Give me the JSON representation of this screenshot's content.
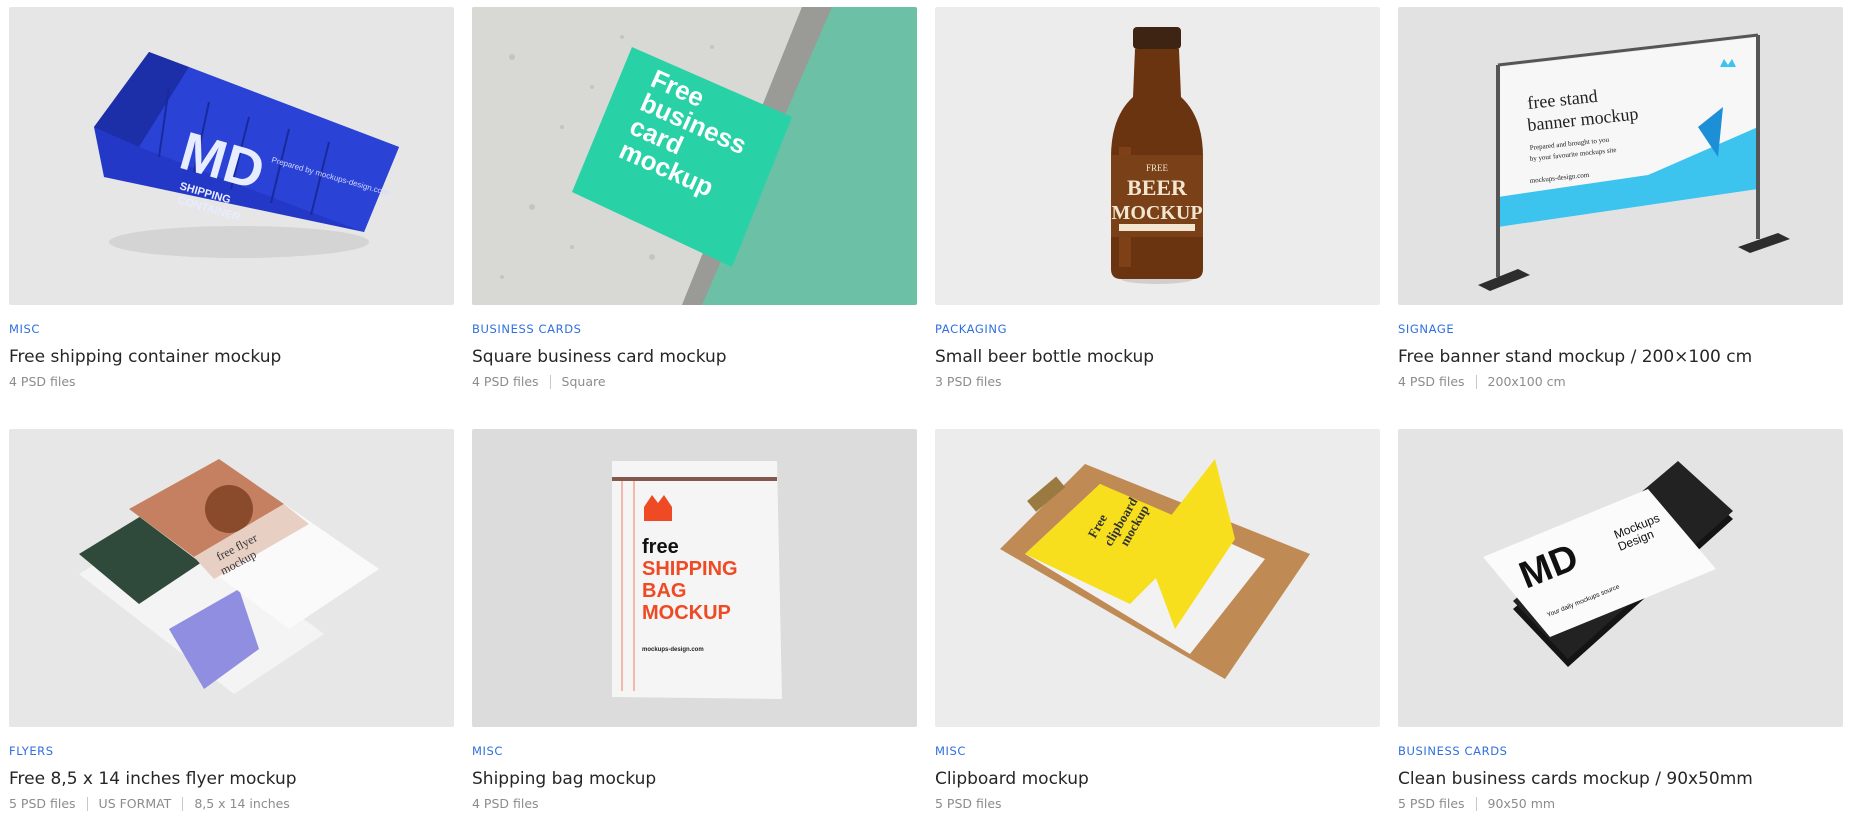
{
  "cards": [
    {
      "category": "MISC",
      "title": "Free shipping container mockup",
      "files": "4 PSD files",
      "tags": [],
      "image": {
        "icon": "shipping-container",
        "text_main": "MD",
        "text_sub1": "SHIPPING",
        "text_sub2": "CONTAINER",
        "text_small": "Prepared by mockups-design.com"
      }
    },
    {
      "category": "BUSINESS CARDS",
      "title": "Square business card mockup",
      "files": "4 PSD files",
      "tags": [
        "Square"
      ],
      "image": {
        "icon": "business-card",
        "l1": "Free",
        "l2": "business",
        "l3": "card",
        "l4": "mockup"
      }
    },
    {
      "category": "PACKAGING",
      "title": "Small beer bottle mockup",
      "files": "3 PSD files",
      "tags": [],
      "image": {
        "icon": "beer-bottle",
        "l1": "FREE",
        "l2": "BEER",
        "l3": "MOCKUP"
      }
    },
    {
      "category": "SIGNAGE",
      "title": "Free banner stand mockup / 200×100 cm",
      "files": "4 PSD files",
      "tags": [
        "200x100 cm"
      ],
      "image": {
        "icon": "banner-stand",
        "l1": "free stand",
        "l2": "banner mockup",
        "l3": "Prepared and brought to you",
        "l4": "by your favourite mockups site",
        "l5": "mockups-design.com"
      }
    },
    {
      "category": "FLYERS",
      "title": "Free 8,5 x 14 inches flyer mockup",
      "files": "5 PSD files",
      "tags": [
        "US FORMAT",
        "8,5 x 14 inches"
      ],
      "image": {
        "icon": "flyer",
        "l1": "free flyer",
        "l2": "mockup"
      }
    },
    {
      "category": "MISC",
      "title": "Shipping bag mockup",
      "files": "4 PSD files",
      "tags": [],
      "image": {
        "icon": "shipping-bag",
        "l1": "free",
        "l2": "SHIPPING",
        "l3": "BAG",
        "l4": "MOCKUP",
        "l5": "mockups-design.com"
      }
    },
    {
      "category": "MISC",
      "title": "Clipboard mockup",
      "files": "5 PSD files",
      "tags": [],
      "image": {
        "icon": "clipboard",
        "l1": "Free",
        "l2": "clipboard",
        "l3": "mockup"
      }
    },
    {
      "category": "BUSINESS CARDS",
      "title": "Clean business cards mockup / 90x50mm",
      "files": "5 PSD files",
      "tags": [
        "90x50 mm"
      ],
      "image": {
        "icon": "business-cards",
        "l1": "MD",
        "l2": "Mockups",
        "l3": "Design",
        "l4": "Your daily mockups source"
      }
    }
  ],
  "colors": {
    "category": "#2f6fe0",
    "title": "#262626",
    "meta": "#8c8c8c",
    "container_blue": "#2438c8",
    "card_green": "#28d2a6",
    "beer_amber": "#6a3410",
    "banner_cyan": "#3cc3ee",
    "bag_red": "#ee4a24",
    "clipboard_yellow": "#f7df1e"
  }
}
